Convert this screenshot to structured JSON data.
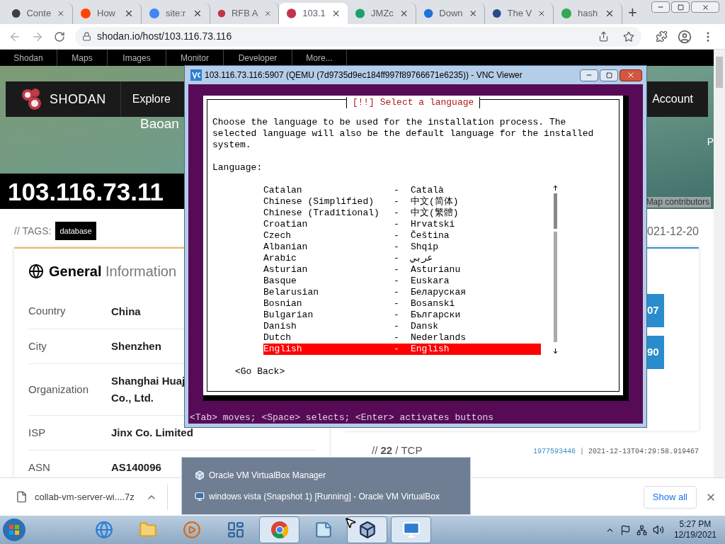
{
  "browser": {
    "tabs": [
      {
        "label": "Conte",
        "selected": false,
        "color": "#3c4043"
      },
      {
        "label": "How",
        "selected": false,
        "color": "#ff4500"
      },
      {
        "label": "site:r",
        "selected": false,
        "color": "#4285f4"
      },
      {
        "label": "RFB A",
        "selected": false,
        "color": "#c2344a"
      },
      {
        "label": "103.1",
        "selected": true,
        "color": "#c2344a"
      },
      {
        "label": "JMZc",
        "selected": false,
        "color": "#1f9e6e"
      },
      {
        "label": "Down",
        "selected": false,
        "color": "#1e73d8"
      },
      {
        "label": "The V",
        "selected": false,
        "color": "#2b4a8a"
      },
      {
        "label": "hash",
        "selected": false,
        "color": "#34a853"
      }
    ],
    "new_tab": "+",
    "url": "shodan.io/host/103.116.73.116"
  },
  "site": {
    "nav": [
      "Shodan",
      "Maps",
      "Images",
      "Monitor",
      "Developer",
      "More..."
    ],
    "logo": "SHODAN",
    "header_links": [
      "Explore"
    ],
    "account": "Account",
    "map_labels": [
      "Baoan",
      "P"
    ],
    "attribution": "Map contributors",
    "ip": "103.116.73.11",
    "tags_label": "// TAGS:",
    "tags": [
      "database"
    ],
    "last_seen": "021-12-20",
    "general": {
      "title_bold": "General",
      "title_rest": "Information",
      "rows": [
        {
          "label": "Country",
          "value": "China"
        },
        {
          "label": "City",
          "value": "Shenzhen"
        },
        {
          "label": "Organization",
          "value": "Shanghai Huaj\nCo., Ltd."
        },
        {
          "label": "ISP",
          "value": "Jinx Co. Limited"
        },
        {
          "label": "ASN",
          "value": "AS140096"
        }
      ]
    },
    "ports": [
      "07",
      "90"
    ],
    "service": "// **22** / TCP",
    "banner_id": "1977593446",
    "banner_separator": "|",
    "banner_time": "2021-12-13T04:29:58.919467"
  },
  "vnc": {
    "title": "103.116.73.116:5907 (QEMU (7d9735d9ec184ff997f89766671e6235)) - VNC Viewer",
    "dialog_title": "[!!] Select a language",
    "intro": "Choose the language to be used for the installation process. The selected language will also be the default language for the installed system.",
    "field_label": "Language:",
    "languages": [
      {
        "name": "Catalan",
        "separator": "-",
        "native": "Català",
        "selected": false
      },
      {
        "name": "Chinese (Simplified)",
        "separator": "-",
        "native": "中文(简体)",
        "selected": false
      },
      {
        "name": "Chinese (Traditional)",
        "separator": "-",
        "native": "中文(繁體)",
        "selected": false
      },
      {
        "name": "Croatian",
        "separator": "-",
        "native": "Hrvatski",
        "selected": false
      },
      {
        "name": "Czech",
        "separator": "-",
        "native": "Čeština",
        "selected": false
      },
      {
        "name": "Albanian",
        "separator": "-",
        "native": "Shqip",
        "selected": false
      },
      {
        "name": "Arabic",
        "separator": "-",
        "native": "عربي",
        "selected": false
      },
      {
        "name": "Asturian",
        "separator": "-",
        "native": "Asturianu",
        "selected": false
      },
      {
        "name": "Basque",
        "separator": "-",
        "native": "Euskara",
        "selected": false
      },
      {
        "name": "Belarusian",
        "separator": "-",
        "native": "Беларуская",
        "selected": false
      },
      {
        "name": "Bosnian",
        "separator": "-",
        "native": "Bosanski",
        "selected": false
      },
      {
        "name": "Bulgarian",
        "separator": "-",
        "native": "Български",
        "selected": false
      },
      {
        "name": "Danish",
        "separator": "-",
        "native": "Dansk",
        "selected": false
      },
      {
        "name": "Dutch",
        "separator": "-",
        "native": "Nederlands",
        "selected": false
      },
      {
        "name": "English",
        "separator": "-",
        "native": "English",
        "selected": true
      }
    ],
    "go_back": "<Go Back>",
    "status": "<Tab> moves; <Space> selects; <Enter> activates buttons"
  },
  "downloads": {
    "file": "collab-vm-server-wi....7z",
    "show_all": "Show all"
  },
  "taskbar": {
    "apps": [
      {
        "kind": "ie",
        "active": false
      },
      {
        "kind": "explorer",
        "active": false
      },
      {
        "kind": "media",
        "active": false
      },
      {
        "kind": "control",
        "active": false
      },
      {
        "kind": "chrome",
        "active": true
      },
      {
        "kind": "notepad",
        "active": false
      },
      {
        "kind": "virtualbox",
        "active": true
      },
      {
        "kind": "vnc",
        "active": true
      }
    ],
    "time": "5:27 PM",
    "date": "12/19/2021",
    "popup": [
      {
        "kind": "manager",
        "label": "Oracle VM VirtualBox Manager"
      },
      {
        "kind": "vm",
        "label": "windows vista (Snapshot 1) [Running] - Oracle VM VirtualBox"
      }
    ]
  }
}
